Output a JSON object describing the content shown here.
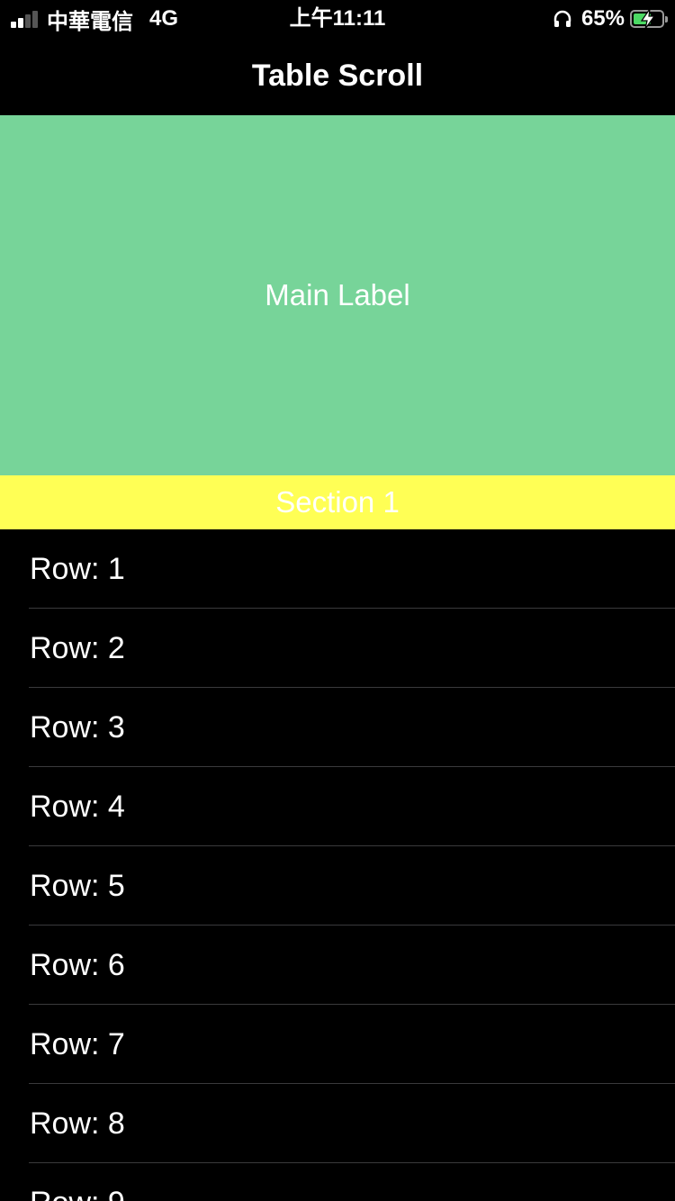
{
  "status_bar": {
    "carrier": "中華電信",
    "network": "4G",
    "time": "上午11:11",
    "battery_percent": "65%",
    "battery_level": 0.65,
    "signal_bars_active": 2,
    "signal_bars_total": 4,
    "icons": [
      "signal-icon",
      "headphone-icon",
      "battery-charging-icon"
    ]
  },
  "nav": {
    "title": "Table Scroll"
  },
  "header": {
    "label": "Main Label",
    "background": "#77d499"
  },
  "section": {
    "title": "Section 1",
    "background": "#ffff55"
  },
  "rows": [
    {
      "label": "Row: 1"
    },
    {
      "label": "Row: 2"
    },
    {
      "label": "Row: 3"
    },
    {
      "label": "Row: 4"
    },
    {
      "label": "Row: 5"
    },
    {
      "label": "Row: 6"
    },
    {
      "label": "Row: 7"
    },
    {
      "label": "Row: 8"
    },
    {
      "label": "Row: 9"
    }
  ],
  "colors": {
    "background": "#000000",
    "text": "#ffffff",
    "separator": "#3a3a3c",
    "battery": "#4cd964"
  }
}
